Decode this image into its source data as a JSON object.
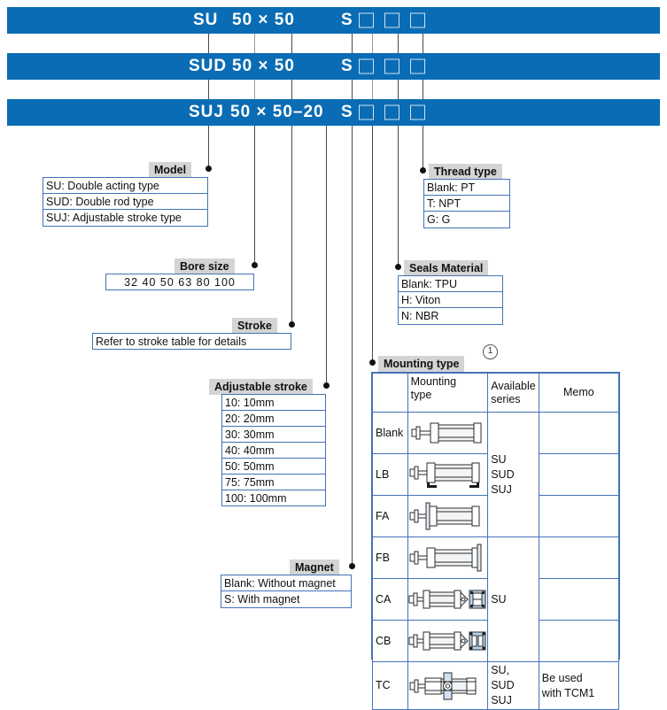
{
  "title": "Cylinder model ordering code",
  "code_bars": [
    {
      "id": "su",
      "segments": [
        {
          "text": "SU",
          "x": 218
        },
        {
          "text": "50 × 50",
          "x": 262
        },
        {
          "text": "S",
          "x": 385
        }
      ],
      "squares_x": [
        405,
        434,
        463
      ]
    },
    {
      "id": "sud",
      "segments": [
        {
          "text": "SUD",
          "x": 213
        },
        {
          "text": "50 × 50",
          "x": 262
        },
        {
          "text": "S",
          "x": 385
        }
      ],
      "squares_x": [
        405,
        434,
        463
      ]
    },
    {
      "id": "suj",
      "segments": [
        {
          "text": "SUJ",
          "x": 213
        },
        {
          "text": "50 × 50–20",
          "x": 262
        },
        {
          "text": "S",
          "x": 385
        }
      ],
      "squares_x": [
        405,
        434,
        463
      ]
    }
  ],
  "callouts": {
    "model": {
      "title": "Model",
      "options": [
        "SU: Double acting type",
        "SUD: Double rod type",
        "SUJ: Adjustable stroke type"
      ]
    },
    "bore_size": {
      "title": "Bore size",
      "options": [
        "32  40  50  63  80  100"
      ]
    },
    "stroke": {
      "title": "Stroke",
      "options": [
        "Refer to stroke table for details"
      ]
    },
    "adjustable_stroke": {
      "title": "Adjustable stroke",
      "options": [
        "10: 10mm",
        "20: 20mm",
        "30: 30mm",
        "40: 40mm",
        "50: 50mm",
        "75: 75mm",
        "100: 100mm"
      ]
    },
    "magnet": {
      "title": "Magnet",
      "options": [
        "Blank: Without magnet",
        "S: With magnet"
      ]
    },
    "thread_type": {
      "title": "Thread type",
      "options": [
        "Blank: PT",
        "T: NPT",
        "G: G"
      ]
    },
    "seals_material": {
      "title": "Seals Material",
      "options": [
        "Blank: TPU",
        "H: Viton",
        "N: NBR"
      ]
    },
    "mounting_type": {
      "title": "Mounting type",
      "note_marker": "1",
      "headers": [
        "",
        "Mounting type",
        "Available series",
        "Memo"
      ],
      "rows": [
        {
          "code": "Blank",
          "icon": "cylinder-basic",
          "series": "",
          "memo": ""
        },
        {
          "code": "LB",
          "icon": "cylinder-foot",
          "series": "SU\nSUD\nSUJ",
          "memo": ""
        },
        {
          "code": "FA",
          "icon": "cylinder-front-flange",
          "series": "",
          "memo": ""
        },
        {
          "code": "FB",
          "icon": "cylinder-rear-flange",
          "series": "",
          "memo": ""
        },
        {
          "code": "CA",
          "icon": "cylinder-clevis-ca",
          "series": "SU",
          "memo": ""
        },
        {
          "code": "CB",
          "icon": "cylinder-clevis-cb",
          "series": "",
          "memo": ""
        },
        {
          "code": "TC",
          "icon": "cylinder-trunnion",
          "series": "SU, SUD\nSUJ",
          "memo": "Be used\nwith TCM1"
        }
      ]
    }
  },
  "colors": {
    "bar_blue": "#0a6cb4",
    "box_border": "#4472b8",
    "tag_grey": "#d4d4d4",
    "leader": "#4a4a4a"
  }
}
